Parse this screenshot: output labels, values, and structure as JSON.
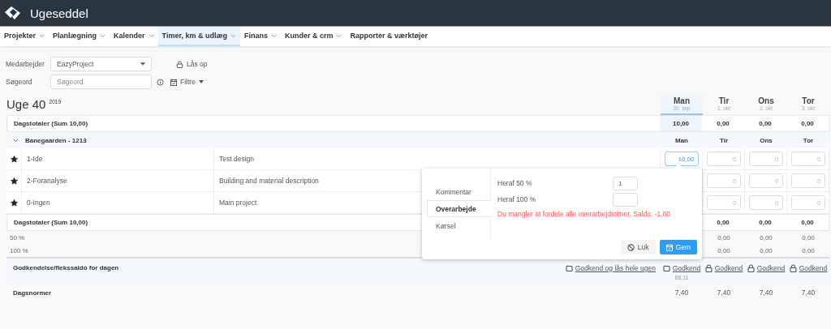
{
  "header": {
    "title": "Ugeseddel"
  },
  "nav": [
    {
      "label": "Projekter",
      "selected": false,
      "dropdown": true
    },
    {
      "label": "Planlægning",
      "selected": false,
      "dropdown": true
    },
    {
      "label": "Kalender",
      "selected": false,
      "dropdown": true
    },
    {
      "label": "Timer, km & udlæg",
      "selected": true,
      "dropdown": true
    },
    {
      "label": "Finans",
      "selected": false,
      "dropdown": true
    },
    {
      "label": "Kunder & crm",
      "selected": false,
      "dropdown": true
    },
    {
      "label": "Rapporter & værktøjer",
      "selected": false,
      "dropdown": false
    }
  ],
  "filters": {
    "employee": {
      "label": "Medarbejder",
      "value": "EazyProject"
    },
    "unlock_link": "Lås op",
    "search": {
      "label": "Søgeord",
      "placeholder": "Søgeord"
    },
    "filter_button": "Filtre"
  },
  "week": {
    "title": "Uge 40",
    "year": "2019"
  },
  "days": [
    {
      "name": "Man",
      "date": "30. sep",
      "selected": true
    },
    {
      "name": "Tir",
      "date": "1. okt",
      "selected": false
    },
    {
      "name": "Ons",
      "date": "2. okt",
      "selected": false
    },
    {
      "name": "Tor",
      "date": "3. okt",
      "selected": false
    }
  ],
  "day_totals": {
    "label": "Dagstotaler (Sum 10,00)",
    "values": [
      "10,00",
      "0,00",
      "0,00",
      "0,00"
    ]
  },
  "group": {
    "name": "Banegaarden - 1213",
    "expanded": true,
    "days": [
      "Man",
      "Tir",
      "Ons",
      "Tor"
    ]
  },
  "tasks": [
    {
      "starred": true,
      "phase": "1-Ide",
      "description": "Test design",
      "values": [
        "10,00",
        "0",
        "0",
        "0"
      ]
    },
    {
      "starred": true,
      "phase": "2-Foranalyse",
      "description": "Building and material description",
      "values": [
        "0",
        "0",
        "0"
      ]
    },
    {
      "starred": true,
      "phase": "0-Ingen",
      "description": "Main project",
      "values": [
        "0",
        "0",
        "0"
      ]
    }
  ],
  "totals_bottom": {
    "label": "Dagstotaler (Sum 10,00)",
    "values": [
      "0,00",
      "0,00",
      "0,00"
    ]
  },
  "overtime_rows": [
    {
      "label": "50 %",
      "values": [
        "0,00",
        "0,00",
        "0,00"
      ]
    },
    {
      "label": "100 %",
      "values": [
        "0,00",
        "0,00",
        "0,00"
      ]
    }
  ],
  "approval": {
    "label": "Godkendelse/flekssaldo for dagen",
    "week_link": {
      "label": "Godkend og lås hele ugen",
      "locked": false
    },
    "days": [
      {
        "label": "Godkend",
        "locked": false,
        "balance": "68,11"
      },
      {
        "label": "Godkend",
        "locked": true
      },
      {
        "label": "Godkend",
        "locked": true
      },
      {
        "label": "Godkend",
        "locked": true
      }
    ]
  },
  "norms": {
    "label": "Dagsnormer",
    "values": [
      "7,40",
      "7,40",
      "7,40",
      "7,40"
    ]
  },
  "popup": {
    "tabs": [
      {
        "label": "Kommentar",
        "selected": false
      },
      {
        "label": "Overarbejde",
        "selected": true
      },
      {
        "label": "Kørsel",
        "selected": false
      }
    ],
    "fields": [
      {
        "label": "Heraf 50 %",
        "value": "1"
      },
      {
        "label": "Heraf 100 %"
      }
    ],
    "error": "Du mangler at fordele alle overarbejdstimer. Saldo: -1,60",
    "buttons": [
      {
        "label": "Luk",
        "kind": "secondary"
      },
      {
        "label": "Gem",
        "kind": "primary"
      }
    ]
  }
}
